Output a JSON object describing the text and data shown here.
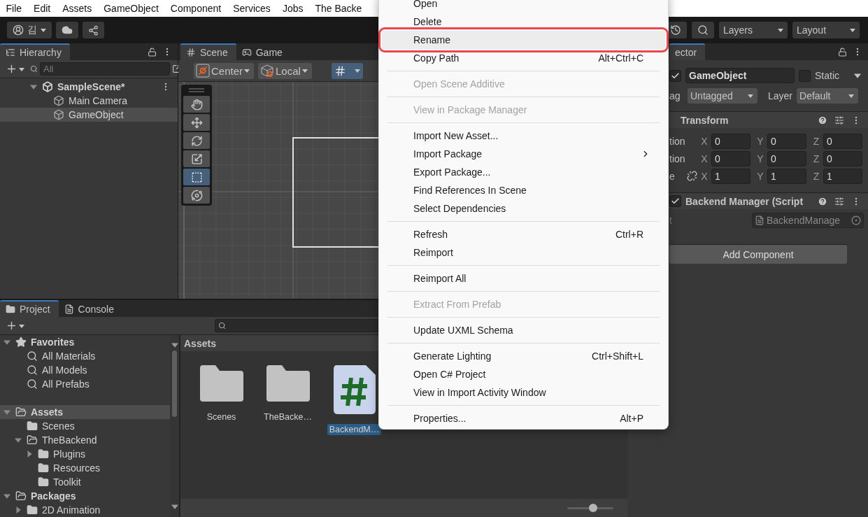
{
  "menubar": [
    "File",
    "Edit",
    "Assets",
    "GameObject",
    "Component",
    "Services",
    "Jobs",
    "The Backe"
  ],
  "toolbar": {
    "account": "김",
    "layers": "Layers",
    "layout": "Layout"
  },
  "hierarchy": {
    "title": "Hierarchy",
    "search_placeholder": "All",
    "scene": {
      "name": "SampleScene*",
      "expanded": true,
      "children": [
        {
          "name": "Main Camera",
          "selected": false
        },
        {
          "name": "GameObject",
          "selected": true
        }
      ]
    }
  },
  "scene": {
    "tabs": [
      {
        "kind": "scene",
        "label": "Scene",
        "selected": true
      },
      {
        "kind": "game",
        "label": "Game",
        "selected": false
      }
    ],
    "pivot": "Center",
    "space": "Local",
    "grid_snap": true,
    "tools": [
      {
        "kind": "view",
        "selected": false
      },
      {
        "kind": "move",
        "selected": false
      },
      {
        "kind": "rotate",
        "selected": false
      },
      {
        "kind": "scale",
        "selected": false
      },
      {
        "kind": "rect",
        "selected": true
      },
      {
        "kind": "transform",
        "selected": false
      }
    ]
  },
  "project": {
    "tabs": [
      {
        "kind": "project",
        "label": "Project",
        "selected": true
      },
      {
        "kind": "console",
        "label": "Console",
        "selected": false
      }
    ],
    "tree": [
      {
        "kind": "favorites",
        "label": "Favorites",
        "expanded": true,
        "selected": false,
        "children": [
          {
            "kind": "search",
            "label": "All Materials",
            "selected": false
          },
          {
            "kind": "search",
            "label": "All Models",
            "selected": false
          },
          {
            "kind": "search",
            "label": "All Prefabs",
            "selected": false
          }
        ]
      },
      {
        "kind": "root",
        "label": "Assets",
        "expanded": true,
        "selected": true,
        "children": [
          {
            "kind": "folder",
            "label": "Scenes",
            "selected": false
          },
          {
            "kind": "folder",
            "label": "TheBackend",
            "expanded": true,
            "selected": false,
            "children": [
              {
                "kind": "folder",
                "label": "Plugins",
                "expanded": false,
                "selected": false
              },
              {
                "kind": "folder",
                "label": "Resources",
                "selected": false
              },
              {
                "kind": "folder",
                "label": "Toolkit",
                "selected": false
              }
            ]
          }
        ]
      },
      {
        "kind": "root",
        "label": "Packages",
        "expanded": true,
        "selected": false,
        "children": [
          {
            "kind": "folder",
            "label": "2D Animation",
            "expanded": false,
            "selected": false
          }
        ]
      }
    ],
    "breadcrumb": "Assets",
    "items": [
      {
        "kind": "folder",
        "label": "Scenes",
        "selected": false
      },
      {
        "kind": "folder",
        "label": "TheBacke…",
        "selected": false
      },
      {
        "kind": "script",
        "label": "BackendM…",
        "selected": true
      }
    ],
    "zoom": {
      "level": 0.56
    }
  },
  "inspector": {
    "tab": "ector",
    "active": true,
    "name": "GameObject",
    "static": false,
    "static_label": "Static",
    "tag_label": "ag",
    "tag": "Untagged",
    "layer_label": "Layer",
    "layer": "Default",
    "components": [
      {
        "kind": "transform",
        "title": "Transform",
        "rows": [
          {
            "kind": "vector",
            "label": "tion",
            "axes": [
              {
                "axis": "X",
                "value": "0"
              },
              {
                "axis": "Y",
                "value": "0"
              },
              {
                "axis": "Z",
                "value": "0"
              }
            ]
          },
          {
            "kind": "vector",
            "label": "tion",
            "axes": [
              {
                "axis": "X",
                "value": "0"
              },
              {
                "axis": "Y",
                "value": "0"
              },
              {
                "axis": "Z",
                "value": "0"
              }
            ]
          },
          {
            "kind": "scale",
            "label": "e",
            "axes": [
              {
                "axis": "X",
                "value": "1"
              },
              {
                "axis": "Y",
                "value": "1"
              },
              {
                "axis": "Z",
                "value": "1"
              }
            ]
          }
        ]
      },
      {
        "kind": "script",
        "title": "Backend Manager (Script",
        "enabled": true,
        "field_label": "t",
        "value": "BackendManage"
      }
    ],
    "add_button": "Add Component"
  },
  "context_menu": [
    {
      "kind": "item",
      "label": "Open",
      "disabled": false,
      "highlighted": false,
      "submenu": false
    },
    {
      "kind": "item",
      "label": "Delete",
      "disabled": false,
      "highlighted": false,
      "submenu": false
    },
    {
      "kind": "item",
      "label": "Rename",
      "disabled": false,
      "highlighted": true,
      "submenu": false
    },
    {
      "kind": "item",
      "label": "Copy Path",
      "shortcut": "Alt+Ctrl+C",
      "disabled": false,
      "highlighted": false,
      "submenu": false
    },
    {
      "kind": "separator"
    },
    {
      "kind": "item",
      "label": "Open Scene Additive",
      "disabled": true,
      "highlighted": false,
      "submenu": false
    },
    {
      "kind": "separator"
    },
    {
      "kind": "item",
      "label": "View in Package Manager",
      "disabled": true,
      "highlighted": false,
      "submenu": false
    },
    {
      "kind": "separator"
    },
    {
      "kind": "item",
      "label": "Import New Asset...",
      "disabled": false,
      "highlighted": false,
      "submenu": false
    },
    {
      "kind": "item",
      "label": "Import Package",
      "disabled": false,
      "highlighted": false,
      "submenu": true
    },
    {
      "kind": "item",
      "label": "Export Package...",
      "disabled": false,
      "highlighted": false,
      "submenu": false
    },
    {
      "kind": "item",
      "label": "Find References In Scene",
      "disabled": false,
      "highlighted": false,
      "submenu": false
    },
    {
      "kind": "item",
      "label": "Select Dependencies",
      "disabled": false,
      "highlighted": false,
      "submenu": false
    },
    {
      "kind": "separator"
    },
    {
      "kind": "item",
      "label": "Refresh",
      "shortcut": "Ctrl+R",
      "disabled": false,
      "highlighted": false,
      "submenu": false
    },
    {
      "kind": "item",
      "label": "Reimport",
      "disabled": false,
      "highlighted": false,
      "submenu": false
    },
    {
      "kind": "separator"
    },
    {
      "kind": "item",
      "label": "Reimport All",
      "disabled": false,
      "highlighted": false,
      "submenu": false
    },
    {
      "kind": "separator"
    },
    {
      "kind": "item",
      "label": "Extract From Prefab",
      "disabled": true,
      "highlighted": false,
      "submenu": false
    },
    {
      "kind": "separator"
    },
    {
      "kind": "item",
      "label": "Update UXML Schema",
      "disabled": false,
      "highlighted": false,
      "submenu": false
    },
    {
      "kind": "separator"
    },
    {
      "kind": "item",
      "label": "Generate Lighting",
      "shortcut": "Ctrl+Shift+L",
      "disabled": false,
      "highlighted": false,
      "submenu": false
    },
    {
      "kind": "item",
      "label": "Open C# Project",
      "disabled": false,
      "highlighted": false,
      "submenu": false
    },
    {
      "kind": "item",
      "label": "View in Import Activity Window",
      "disabled": false,
      "highlighted": false,
      "submenu": false
    },
    {
      "kind": "separator"
    },
    {
      "kind": "item",
      "label": "Properties...",
      "shortcut": "Alt+P",
      "disabled": false,
      "highlighted": false,
      "submenu": false
    }
  ]
}
